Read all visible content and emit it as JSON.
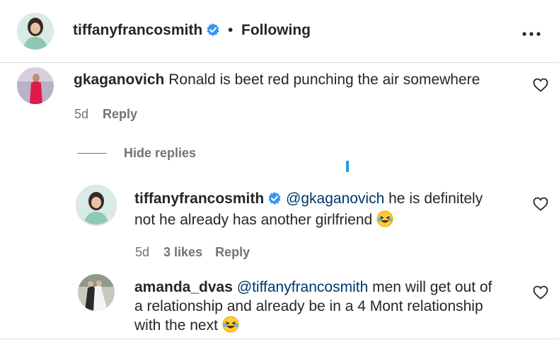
{
  "header": {
    "username": "tiffanyfrancosmith",
    "separator": "•",
    "follow_status": "Following",
    "more_icon": "more-options-icon"
  },
  "comments": [
    {
      "username": "gkaganovich",
      "text": "Ronald is beet red punching the air somewhere",
      "time": "5d",
      "reply_label": "Reply"
    }
  ],
  "hide_replies_label": "Hide replies",
  "replies": [
    {
      "username": "tiffanyfrancosmith",
      "mention": "@gkaganovich",
      "text_line1": "he is definitely",
      "text_line2": "not he already has another girlfriend",
      "time": "5d",
      "likes": "3 likes",
      "reply_label": "Reply"
    },
    {
      "username": "amanda_dvas",
      "mention": "@tiffanyfrancosmith",
      "text_line1": "men will get out of",
      "text_line2": "a relationship and already be in a 4 Mont relationship",
      "text_line3": "with the next"
    }
  ],
  "colors": {
    "verified_blue": "#3897f0",
    "cursor_blue": "#1fa2e3",
    "mention_blue": "#00376b",
    "meta_gray": "#737373"
  }
}
